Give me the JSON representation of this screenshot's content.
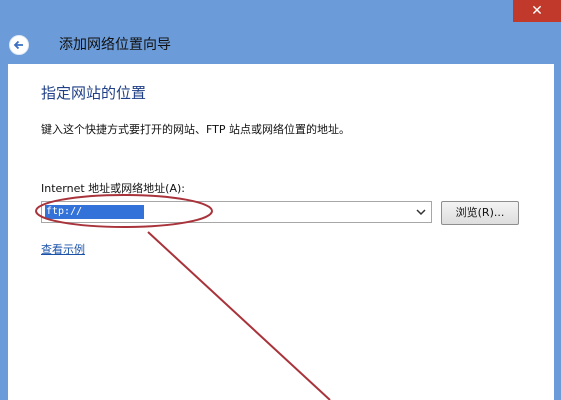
{
  "window": {
    "title": "添加网络位置向导",
    "close_glyph": "✕"
  },
  "page": {
    "heading": "指定网站的位置",
    "description": "键入这个快捷方式要打开的网站、FTP 站点或网络位置的地址。",
    "address_label": "Internet 地址或网络地址(A):",
    "address_value": "ftp://",
    "browse_label": "浏览(R)...",
    "example_link": "查看示例"
  },
  "icons": {
    "back": "back-arrow-icon",
    "dropdown": "chevron-down-icon",
    "close": "close-icon"
  },
  "colors": {
    "window_frame": "#6b9bd8",
    "heading": "#1f3f86",
    "selection": "#3372d9",
    "link": "#1c53a8",
    "annotation": "#a9333a"
  }
}
